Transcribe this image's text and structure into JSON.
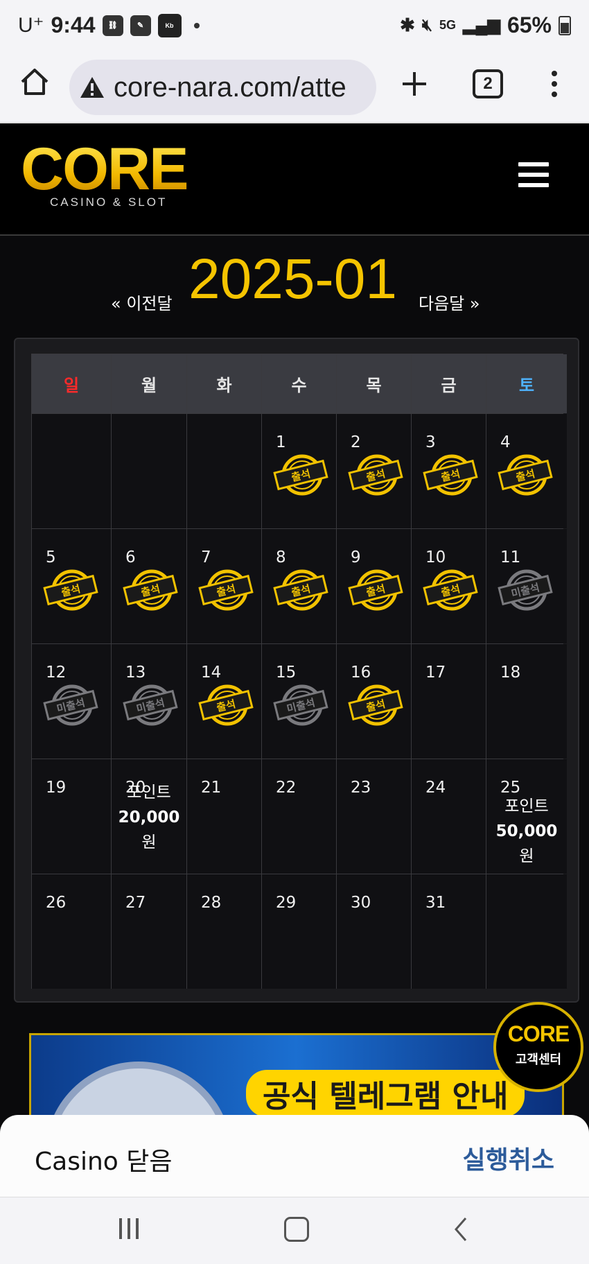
{
  "status_bar": {
    "carrier": "U⁺",
    "time": "9:44",
    "battery": "65%"
  },
  "browser": {
    "url": "core-nara.com/atte",
    "tab_count": "2"
  },
  "site": {
    "logo_text": "CORE",
    "logo_sub": "CASINO & SLOT"
  },
  "month_nav": {
    "prev": "« 이전달",
    "title": "2025-01",
    "next": "다음달 »"
  },
  "calendar": {
    "weekdays": [
      "일",
      "월",
      "화",
      "수",
      "목",
      "금",
      "토"
    ],
    "weeks": [
      [
        {
          "day": "",
          "status": "none"
        },
        {
          "day": "",
          "status": "none"
        },
        {
          "day": "",
          "status": "none"
        },
        {
          "day": "1",
          "status": "attended"
        },
        {
          "day": "2",
          "status": "attended"
        },
        {
          "day": "3",
          "status": "attended"
        },
        {
          "day": "4",
          "status": "attended"
        }
      ],
      [
        {
          "day": "5",
          "status": "attended"
        },
        {
          "day": "6",
          "status": "attended"
        },
        {
          "day": "7",
          "status": "attended"
        },
        {
          "day": "8",
          "status": "attended"
        },
        {
          "day": "9",
          "status": "attended"
        },
        {
          "day": "10",
          "status": "attended"
        },
        {
          "day": "11",
          "status": "missed"
        }
      ],
      [
        {
          "day": "12",
          "status": "missed"
        },
        {
          "day": "13",
          "status": "missed"
        },
        {
          "day": "14",
          "status": "attended"
        },
        {
          "day": "15",
          "status": "missed"
        },
        {
          "day": "16",
          "status": "attended"
        },
        {
          "day": "17",
          "status": "none"
        },
        {
          "day": "18",
          "status": "none"
        }
      ],
      [
        {
          "day": "19",
          "status": "none"
        },
        {
          "day": "20",
          "status": "reward",
          "reward_label": "포인트",
          "reward_amount": "20,000",
          "reward_unit": "원"
        },
        {
          "day": "21",
          "status": "none"
        },
        {
          "day": "22",
          "status": "none"
        },
        {
          "day": "23",
          "status": "none"
        },
        {
          "day": "24",
          "status": "none"
        },
        {
          "day": "25",
          "status": "reward",
          "reward_label": "포인트",
          "reward_amount": "50,000",
          "reward_unit": "원"
        }
      ],
      [
        {
          "day": "26",
          "status": "none"
        },
        {
          "day": "27",
          "status": "none"
        },
        {
          "day": "28",
          "status": "none"
        },
        {
          "day": "29",
          "status": "none"
        },
        {
          "day": "30",
          "status": "none"
        },
        {
          "day": "31",
          "status": "none"
        },
        {
          "day": "",
          "status": "none"
        }
      ]
    ],
    "stamp_attended": "출석",
    "stamp_missed": "미출석"
  },
  "banner": {
    "text": "공식 텔레그램 안내"
  },
  "cs_badge": {
    "logo": "CORE",
    "label": "고객센터"
  },
  "snackbar": {
    "message": "Casino 닫음",
    "action": "실행취소"
  },
  "colors": {
    "accent_gold": "#f5c400",
    "sunday": "#ff2a2a",
    "saturday": "#4fb4ff",
    "undo_blue": "#2c5b9a"
  }
}
